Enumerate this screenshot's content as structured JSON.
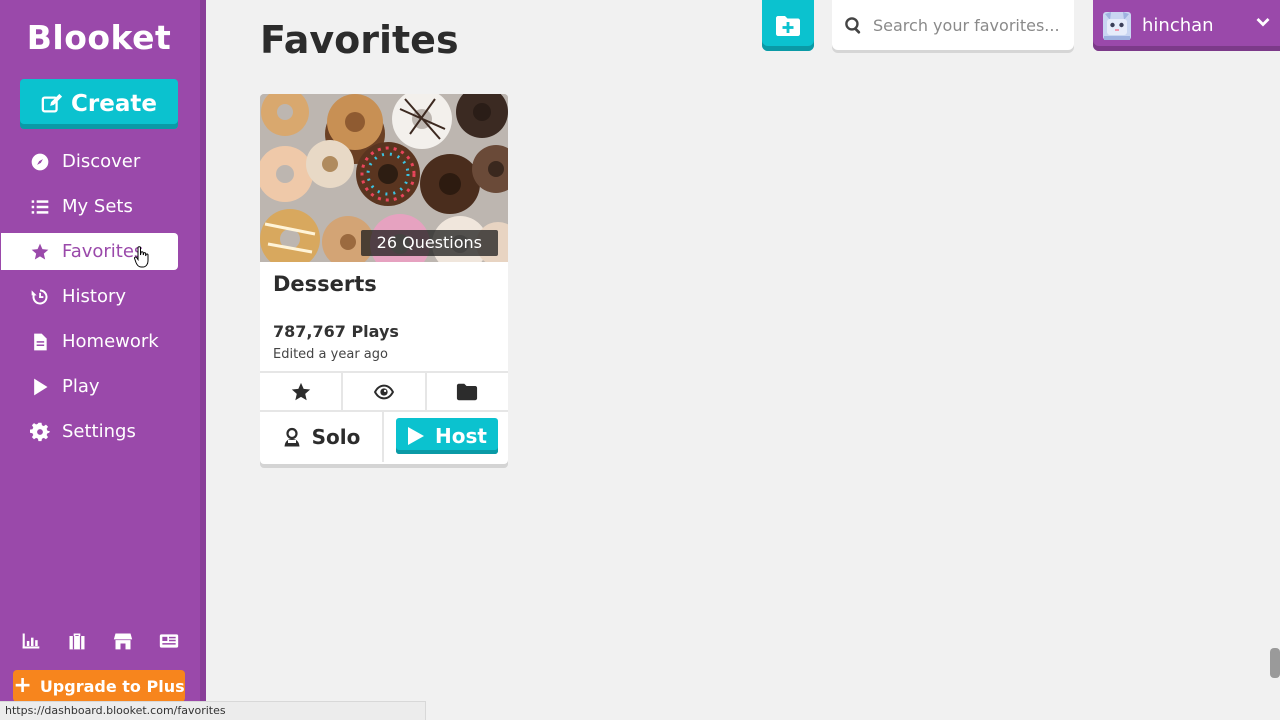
{
  "sidebar": {
    "logo": "Blooket",
    "create_label": "Create",
    "items": [
      {
        "label": "Discover",
        "icon": "compass-icon"
      },
      {
        "label": "My Sets",
        "icon": "list-icon"
      },
      {
        "label": "Favorites",
        "icon": "star-icon",
        "active": true
      },
      {
        "label": "History",
        "icon": "history-icon"
      },
      {
        "label": "Homework",
        "icon": "document-icon"
      },
      {
        "label": "Play",
        "icon": "play-icon"
      },
      {
        "label": "Settings",
        "icon": "gear-icon"
      }
    ],
    "bottom_icons": [
      "stats-icon",
      "suitcase-icon",
      "store-icon",
      "news-icon"
    ],
    "upgrade_label": "Upgrade to Plus"
  },
  "header": {
    "title": "Favorites",
    "search_placeholder": "Search your favorites...",
    "username": "hinchan"
  },
  "card": {
    "questions": "26 Questions",
    "title": "Desserts",
    "plays": "787,767 Plays",
    "edited": "Edited a year ago",
    "solo_label": "Solo",
    "host_label": "Host"
  },
  "status_bar": {
    "url": "https://dashboard.blooket.com/favorites"
  },
  "colors": {
    "sidebar": "#9a49aa",
    "accent": "#0bc2cf",
    "upgrade": "#f7851d",
    "background": "#f1f1f1"
  }
}
